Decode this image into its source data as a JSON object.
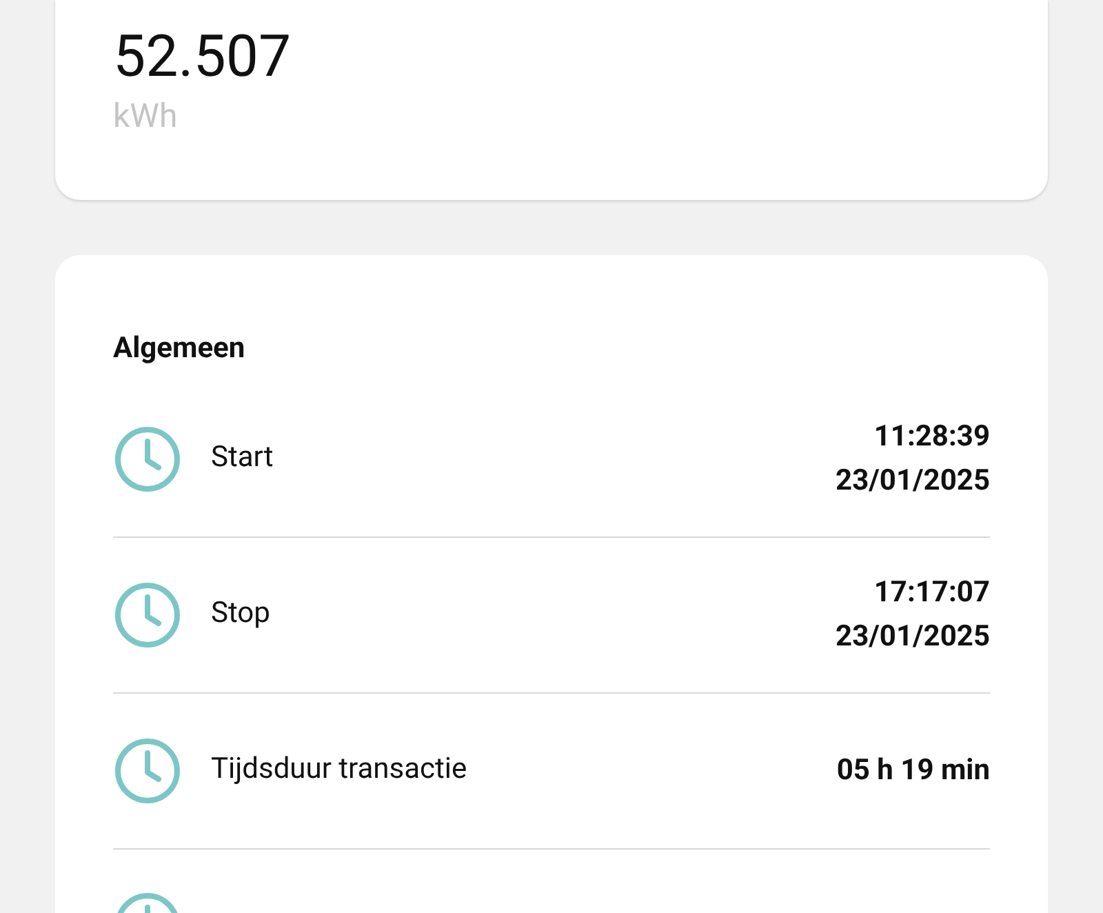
{
  "energy": {
    "value": "52.507",
    "unit": "kWh"
  },
  "general": {
    "title": "Algemeen",
    "rows": [
      {
        "label": "Start",
        "values": [
          "11:28:39",
          "23/01/2025"
        ]
      },
      {
        "label": "Stop",
        "values": [
          "17:17:07",
          "23/01/2025"
        ]
      },
      {
        "label": "Tijdsduur transactie",
        "values": [
          "05 h 19 min"
        ]
      }
    ]
  }
}
